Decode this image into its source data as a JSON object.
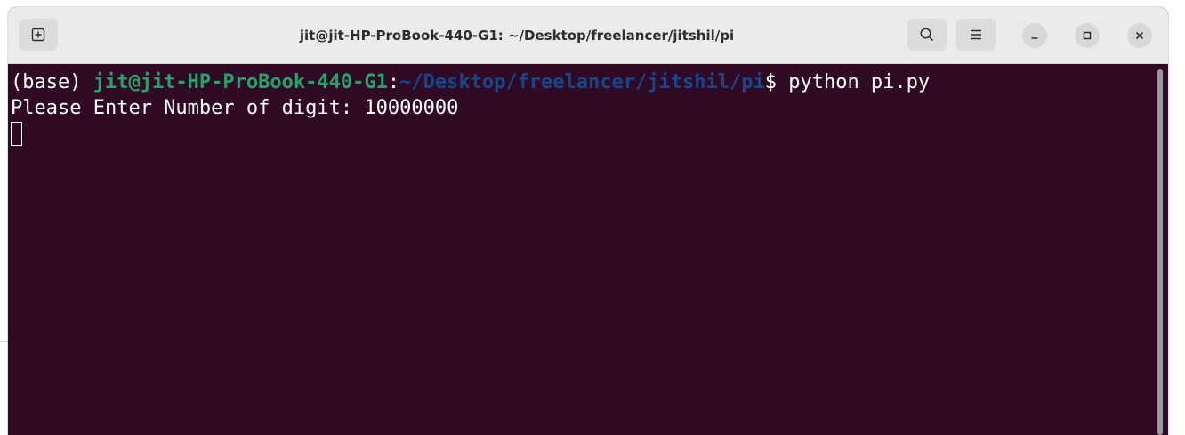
{
  "window": {
    "title": "jit@jit-HP-ProBook-440-G1: ~/Desktop/freelancer/jitshil/pi"
  },
  "icons": {
    "new_tab": "new-tab-icon",
    "search": "search-icon",
    "menu": "hamburger-menu-icon",
    "minimize": "minimize-icon",
    "maximize": "maximize-icon",
    "close": "close-icon"
  },
  "colors": {
    "terminal_bg": "#300a24",
    "prompt_user": "#26a269",
    "prompt_path": "#12488b",
    "text": "#ffffff",
    "titlebar_bg": "#ebebeb"
  },
  "terminal": {
    "prompt": {
      "env": "(base) ",
      "user_host": "jit@jit-HP-ProBook-440-G1",
      "separator": ":",
      "path": "~/Desktop/freelancer/jitshil/pi",
      "symbol": "$ ",
      "command": "python pi.py"
    },
    "output_line": "Please Enter Number of digit: 10000000"
  }
}
